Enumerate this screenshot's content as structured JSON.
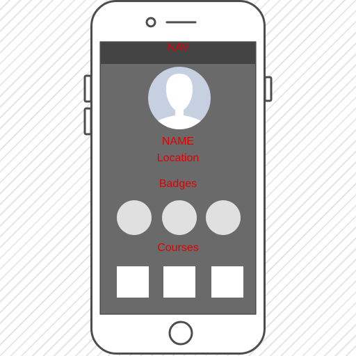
{
  "nav": {
    "title": "NAV"
  },
  "profile": {
    "name": "NAME",
    "location": "Location",
    "avatar_icon": "user-avatar-icon"
  },
  "badges": {
    "title": "Badges",
    "items": [
      {
        "icon": "badge-placeholder"
      },
      {
        "icon": "badge-placeholder"
      },
      {
        "icon": "badge-placeholder"
      }
    ]
  },
  "courses": {
    "title": "Courses",
    "items": [
      {
        "icon": "course-placeholder"
      },
      {
        "icon": "course-placeholder"
      },
      {
        "icon": "course-placeholder"
      }
    ]
  },
  "colors": {
    "label_text": "#e00000",
    "screen": "#6a6a6a",
    "nav_bar": "#444444",
    "placeholder": "#e0e0e0",
    "avatar_bg": "#c7d0e0",
    "phone_outline": "#4d4d4d"
  }
}
